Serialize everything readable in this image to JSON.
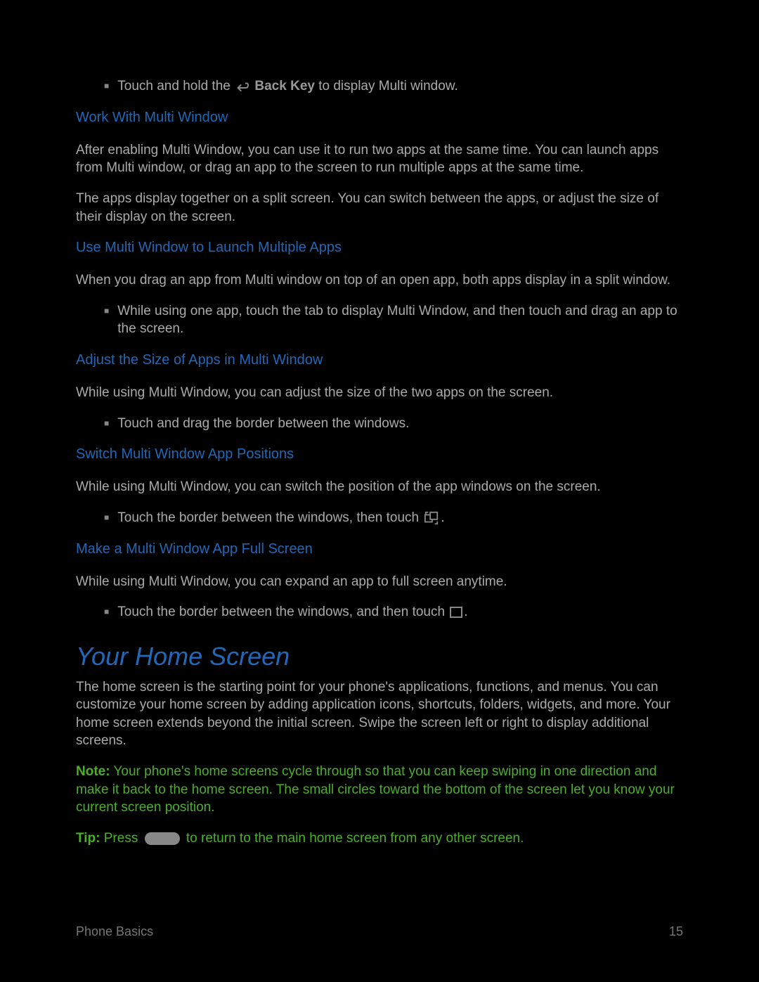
{
  "b1_pre": "Touch and hold the ",
  "b1_key": "Back Key",
  "b1_post": " to display Multi window.",
  "h1": "Work With Multi Window",
  "p1": "After enabling Multi Window, you can use it to run two apps at the same time. You can launch apps from Multi window, or drag an app to the screen to run multiple apps at the same time.",
  "p2": "The apps display together on a split screen. You can switch between the apps, or adjust the size of their display on the screen.",
  "h2": "Use Multi Window to Launch Multiple Apps",
  "p3": "When you drag an app from Multi window on top of an open app, both apps display in a split window.",
  "b2": "While using one app, touch the tab to display Multi Window, and then touch and drag an app to the screen.",
  "h3": "Adjust the Size of Apps in Multi Window",
  "p4": "While using Multi Window, you can adjust the size of the two apps on the screen.",
  "b3": "Touch and drag the border between the windows.",
  "h4": "Switch Multi Window App Positions",
  "p5": "While using Multi Window, you can switch the position of the app windows on the screen.",
  "b4": "Touch the border between the windows, then touch ",
  "b4_end": ".",
  "h5": "Make a Multi Window App Full Screen",
  "p6": "While using Multi Window, you can expand an app to full screen anytime.",
  "b5": "Touch the border between the windows, and then touch ",
  "b5_end": ".",
  "bigh": "Your Home Screen",
  "p7": "The home screen is the starting point for your phone's applications, functions, and menus. You can customize your home screen by adding application icons, shortcuts, folders, widgets, and more. Your home screen extends beyond the initial screen. Swipe the screen left or right to display additional screens.",
  "note_label": "Note:",
  "note_text": " Your phone's home screens cycle through so that you can keep swiping in one direction and make it back to the home screen. The small circles toward the bottom of the screen let you know your current screen position.",
  "tip_label": "Tip:",
  "tip_pre": " Press ",
  "tip_post": " to return to the main home screen from any other screen.",
  "footer_left": "Phone Basics",
  "footer_right": "15"
}
